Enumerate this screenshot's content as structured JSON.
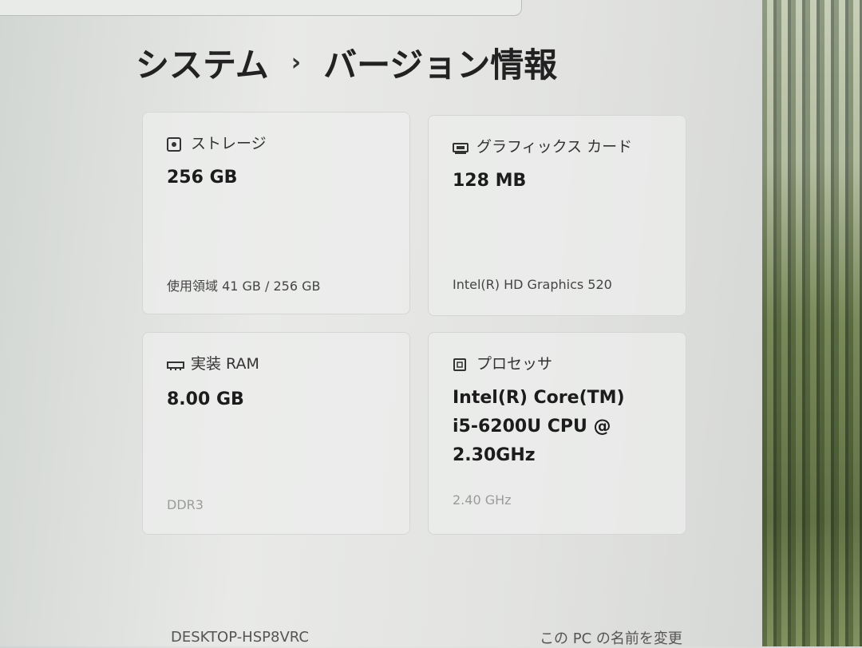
{
  "breadcrumb": {
    "parent": "システム",
    "separator": "›",
    "current": "バージョン情報"
  },
  "cards": {
    "storage": {
      "label": "ストレージ",
      "value": "256 GB",
      "sub": "使用領域 41 GB / 256 GB"
    },
    "graphics": {
      "label": "グラフィックス カード",
      "value": "128 MB",
      "sub": "Intel(R) HD Graphics 520"
    },
    "ram": {
      "label": "実装 RAM",
      "value": "8.00 GB",
      "sub": "DDR3"
    },
    "processor": {
      "label": "プロセッサ",
      "value_lines": [
        "Intel(R) Core(TM)",
        "i5-6200U CPU @",
        "2.30GHz"
      ],
      "sub": "2.40 GHz"
    }
  },
  "footer": {
    "device_name": "DESKTOP-HSP8VRC",
    "rename_link": "この PC の名前を変更"
  }
}
